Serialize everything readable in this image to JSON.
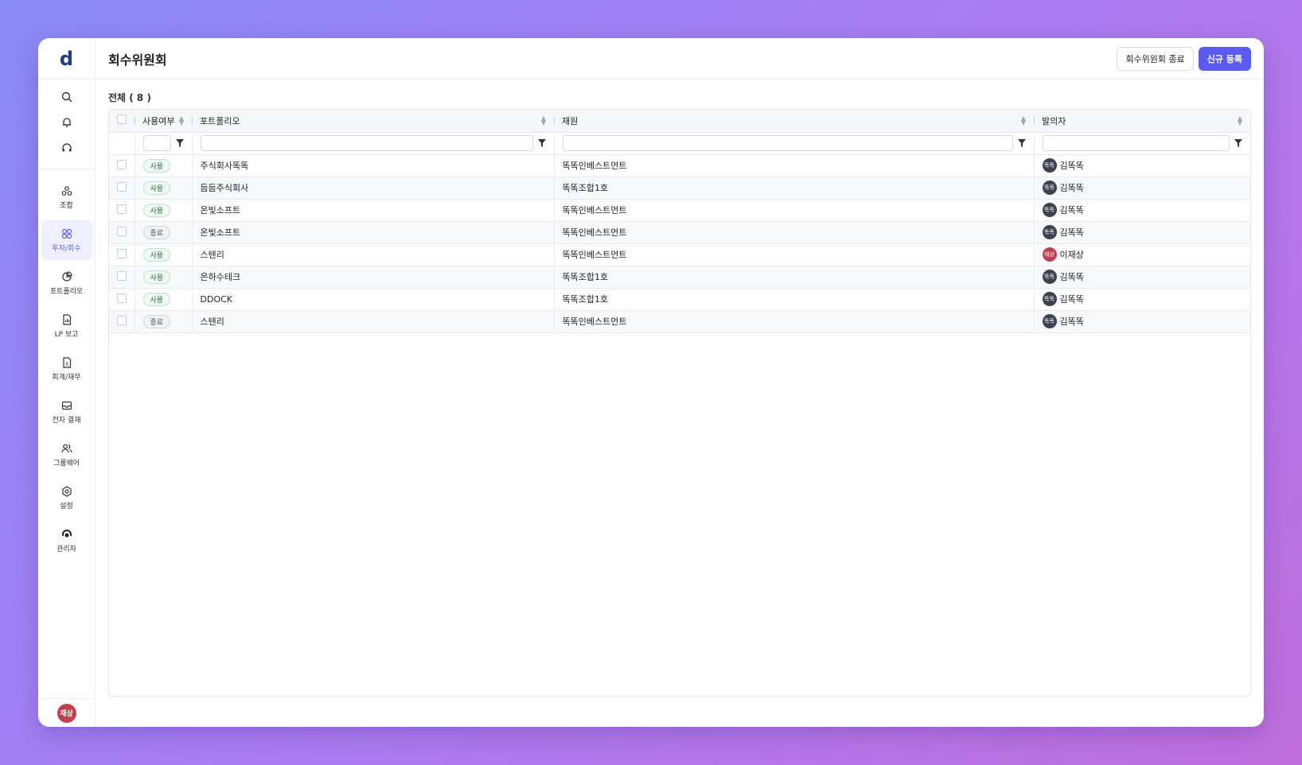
{
  "app": {
    "logo": "d",
    "user_avatar": "재상"
  },
  "sidebar": {
    "items": [
      {
        "label": "조합",
        "icon": "union-icon",
        "active": false
      },
      {
        "label": "투자/회수",
        "icon": "investment-icon",
        "active": true
      },
      {
        "label": "포트폴리오",
        "icon": "pie-chart-icon",
        "active": false
      },
      {
        "label": "LP 보고",
        "icon": "report-icon",
        "active": false
      },
      {
        "label": "회계/재무",
        "icon": "accounting-icon",
        "active": false
      },
      {
        "label": "전자 결재",
        "icon": "approval-icon",
        "active": false
      },
      {
        "label": "그룹웨어",
        "icon": "groupware-icon",
        "active": false
      },
      {
        "label": "설정",
        "icon": "settings-icon",
        "active": false
      },
      {
        "label": "관리자",
        "icon": "admin-icon",
        "active": false
      }
    ]
  },
  "header": {
    "title": "회수위원회",
    "end_button": "회수위원회 종료",
    "new_button": "신규 등록"
  },
  "summary": {
    "count_label": "전체 ( 8 )"
  },
  "table": {
    "columns": [
      "사용여부",
      "포트폴리오",
      "재원",
      "발의자"
    ],
    "rows": [
      {
        "status": "사용",
        "portfolio": "주식회사똑똑",
        "fund": "똑똑인베스트먼트",
        "avatar": "똑똑",
        "proposer": "김똑똑"
      },
      {
        "status": "사용",
        "portfolio": "듬듬주식회사",
        "fund": "똑똑조합1호",
        "avatar": "똑똑",
        "proposer": "김똑똑"
      },
      {
        "status": "사용",
        "portfolio": "온빛소프트",
        "fund": "똑똑인베스트먼트",
        "avatar": "똑똑",
        "proposer": "김똑똑"
      },
      {
        "status": "종료",
        "portfolio": "온빛소프트",
        "fund": "똑똑인베스트먼트",
        "avatar": "똑똑",
        "proposer": "김똑똑"
      },
      {
        "status": "사용",
        "portfolio": "스텐리",
        "fund": "똑똑인베스트먼트",
        "avatar": "재상",
        "proposer": "이재상"
      },
      {
        "status": "사용",
        "portfolio": "은하수테크",
        "fund": "똑똑조합1호",
        "avatar": "똑똑",
        "proposer": "김똑똑"
      },
      {
        "status": "사용",
        "portfolio": "DDOCK",
        "fund": "똑똑조합1호",
        "avatar": "똑똑",
        "proposer": "김똑똑"
      },
      {
        "status": "종료",
        "portfolio": "스텐리",
        "fund": "똑똑인베스트먼트",
        "avatar": "똑똑",
        "proposer": "김똑똑"
      }
    ]
  },
  "colors": {
    "accent": "#5b5bf2",
    "active_badge": "#eefaf2",
    "avatar_red": "#c0404d"
  }
}
